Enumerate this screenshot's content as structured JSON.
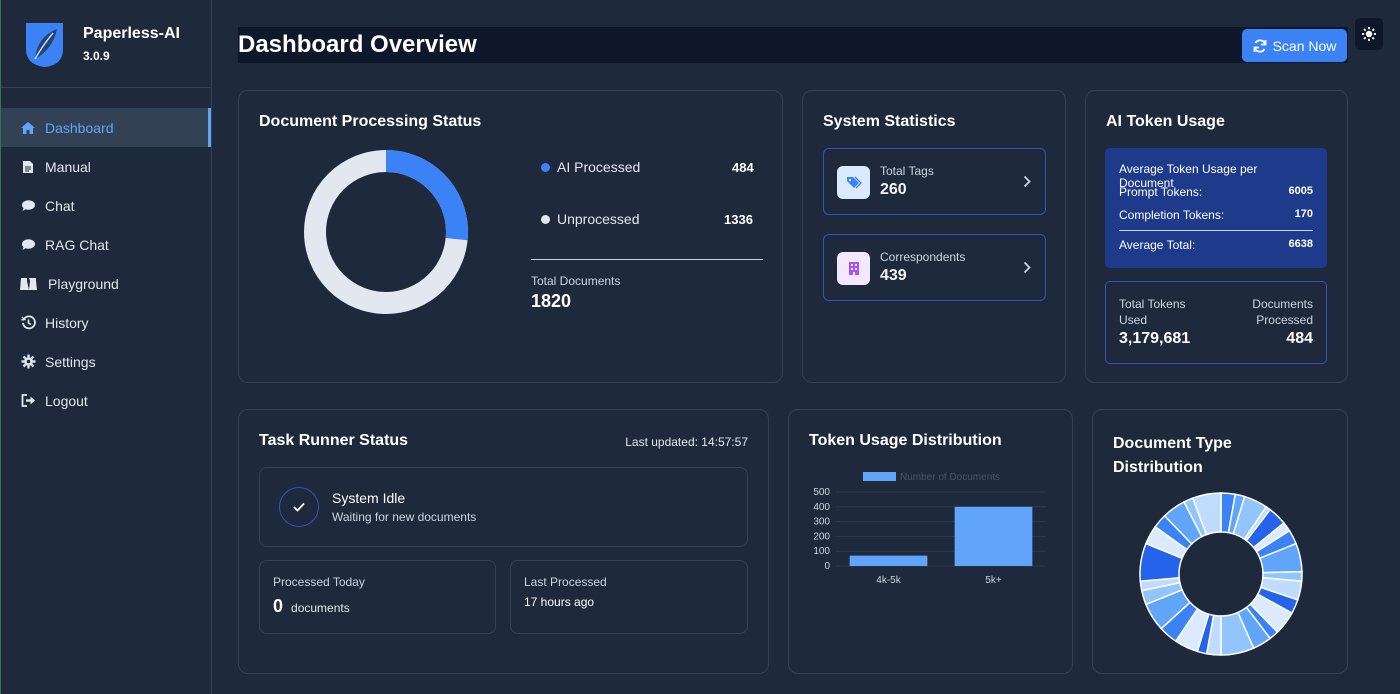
{
  "sidebar": {
    "app_name": "Paperless-AI",
    "version": "3.0.9",
    "items": [
      {
        "label": "Dashboard",
        "icon": "home-icon"
      },
      {
        "label": "Manual",
        "icon": "file-icon"
      },
      {
        "label": "Chat",
        "icon": "comment-icon"
      },
      {
        "label": "RAG Chat",
        "icon": "comment-icon"
      },
      {
        "label": "Playground",
        "icon": "flask-icon"
      },
      {
        "label": "History",
        "icon": "history-icon"
      },
      {
        "label": "Settings",
        "icon": "gear-icon"
      },
      {
        "label": "Logout",
        "icon": "logout-icon"
      }
    ]
  },
  "header": {
    "title": "Dashboard Overview",
    "scan_label": "Scan Now"
  },
  "doc_status": {
    "title": "Document Processing Status",
    "processed_label": "AI Processed",
    "processed_value": "484",
    "unprocessed_label": "Unprocessed",
    "unprocessed_value": "1336",
    "total_label": "Total Documents",
    "total_value": "1820",
    "processed_fraction": 0.266
  },
  "system_stats": {
    "title": "System Statistics",
    "tags_label": "Total Tags",
    "tags_value": "260",
    "corr_label": "Correspondents",
    "corr_value": "439"
  },
  "token_usage": {
    "title": "AI Token Usage",
    "avg_heading": "Average Token Usage per Document",
    "prompt_label": "Prompt Tokens:",
    "prompt_value": "6005",
    "completion_label": "Completion Tokens:",
    "completion_value": "170",
    "avg_total_label": "Average Total:",
    "avg_total_value": "6638",
    "total_used_label_1": "Total Tokens",
    "total_used_label_2": "Used",
    "total_used_value": "3,179,681",
    "docs_processed_label_1": "Documents",
    "docs_processed_label_2": "Processed",
    "docs_processed_value": "484"
  },
  "task_runner": {
    "title": "Task Runner Status",
    "last_updated": "Last updated: 14:57:57",
    "status_title": "System Idle",
    "status_sub": "Waiting for new documents",
    "processed_today_label": "Processed Today",
    "processed_today_value": "0",
    "processed_today_unit": "documents",
    "last_processed_label": "Last Processed",
    "last_processed_value": "17 hours ago"
  },
  "token_distribution": {
    "title": "Token Usage Distribution"
  },
  "doc_type": {
    "title_1": "Document Type",
    "title_2": "Distribution"
  },
  "colors": {
    "accent": "#3b82f6",
    "processed": "#3b82f6",
    "unprocessed": "#e2e8f0",
    "bar": "#60a5fa"
  },
  "chart_data": [
    {
      "type": "bar",
      "categories": [
        "4k-5k",
        "5k+"
      ],
      "series": [
        {
          "name": "Number of Documents",
          "values": [
            70,
            400
          ]
        }
      ],
      "ylim": [
        0,
        500
      ],
      "yticks": [
        "500",
        "400",
        "300",
        "200",
        "100",
        "0"
      ],
      "legend": "top"
    },
    {
      "type": "pie",
      "slices": [
        0.03,
        0.02,
        0.05,
        0.01,
        0.04,
        0.02,
        0.03,
        0.06,
        0.02,
        0.04,
        0.03,
        0.05,
        0.02,
        0.04,
        0.07,
        0.03,
        0.02,
        0.05,
        0.04,
        0.06,
        0.03,
        0.02,
        0.08,
        0.04,
        0.03,
        0.05,
        0.02,
        0.06
      ]
    }
  ]
}
